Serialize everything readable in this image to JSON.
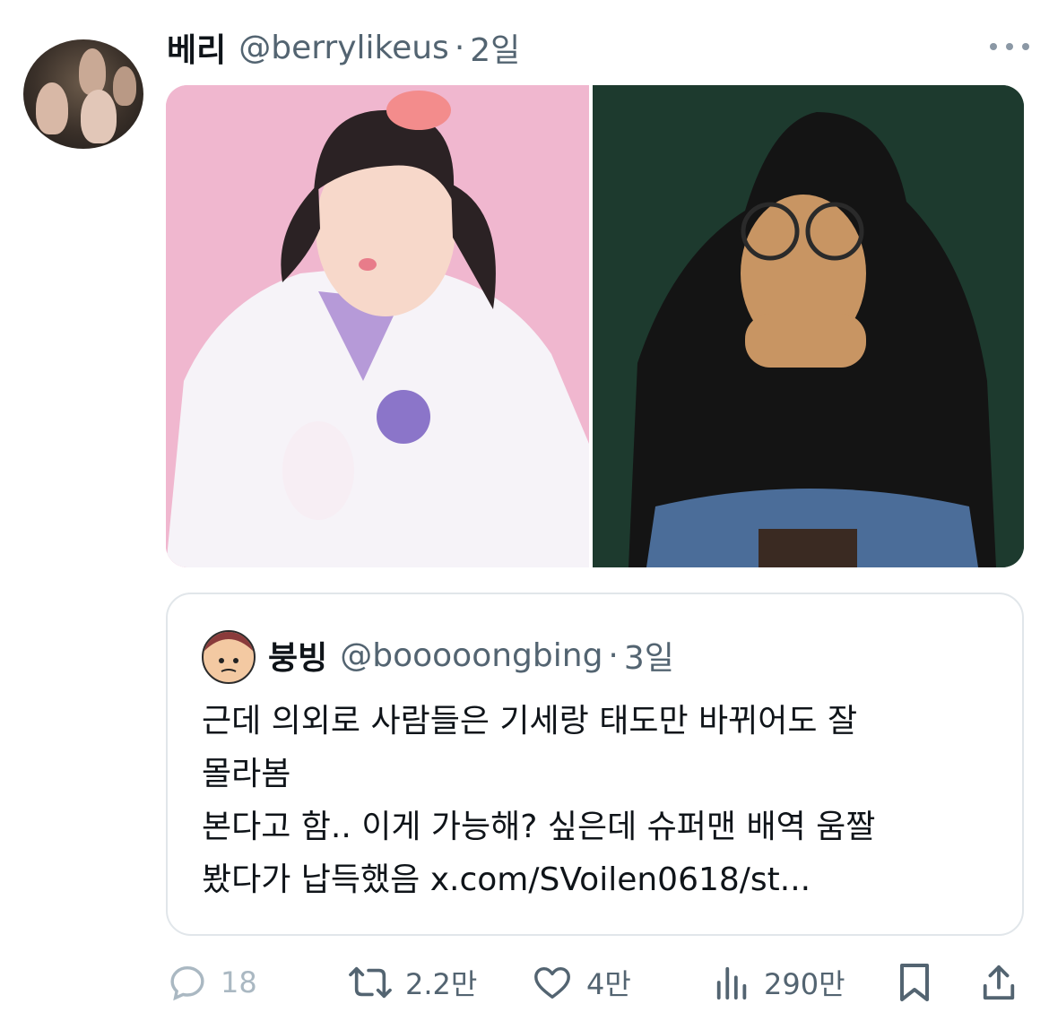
{
  "tweet": {
    "display_name": "베리",
    "handle": "@berrylikeus",
    "separator": "·",
    "time": "2일",
    "more_icon": "more-horizontal-icon"
  },
  "media": {
    "left_bg": "#f0b7cf",
    "right_bg": "#1d3a2e"
  },
  "quote": {
    "display_name": "붕빙",
    "handle": "@booooongbing",
    "separator": "·",
    "time": "3일",
    "lines": [
      "근데 의외로 사람들은 기세랑 태도만 바뀌어도 잘",
      "몰라봄",
      "본다고 함.. 이게 가능해? 싶은데 슈퍼맨 배역 움짤",
      "봤다가 납득했음 x.com/SVoilen0618/st..."
    ]
  },
  "actions": {
    "reply_count": "18",
    "retweet_count": "2.2만",
    "like_count": "4만",
    "views_count": "290만"
  },
  "colors": {
    "text": "#0f1419",
    "muted": "#536471",
    "border": "#e1e6ea"
  }
}
